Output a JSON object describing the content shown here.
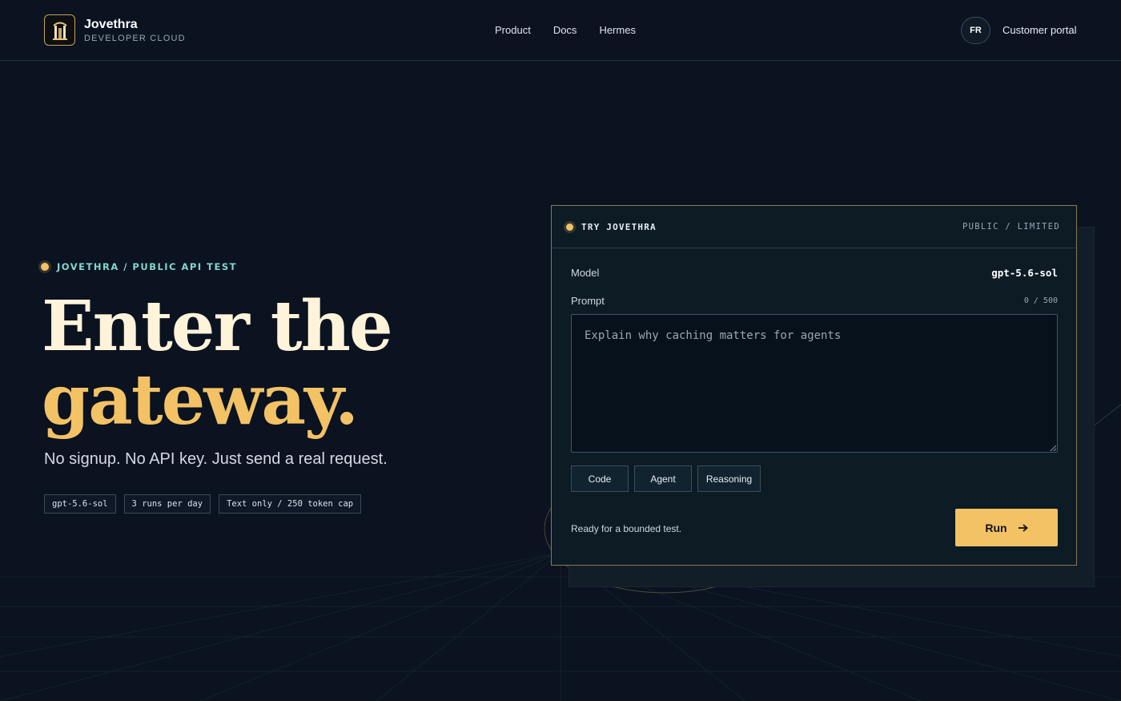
{
  "brand": {
    "name": "Jovethra",
    "subtitle": "DEVELOPER CLOUD"
  },
  "nav": {
    "items": [
      "Product",
      "Docs",
      "Hermes"
    ],
    "language": "FR",
    "portal_label": "Customer portal"
  },
  "hero": {
    "eyebrow": "JOVETHRA / PUBLIC API TEST",
    "headline_line1": "Enter the",
    "headline_line2": "gateway.",
    "subhead": "No signup. No API key. Just send a real request.",
    "chips": [
      "gpt-5.6-sol",
      "3 runs per day",
      "Text only / 250 token cap"
    ]
  },
  "panel": {
    "title": "TRY JOVETHRA",
    "access": "PUBLIC / LIMITED",
    "model_label": "Model",
    "model_value": "gpt-5.6-sol",
    "prompt_label": "Prompt",
    "prompt_counter": "0 / 500",
    "prompt_value": "",
    "prompt_placeholder": "Explain why caching matters for agents",
    "presets": [
      "Code",
      "Agent",
      "Reasoning"
    ],
    "status": "Ready for a bounded test.",
    "run_label": "Run"
  },
  "colors": {
    "background": "#0b1220",
    "accent": "#f2c265",
    "teal": "#7fd8d0",
    "headline_light": "#fff3da"
  },
  "icons": {
    "logo": "pillar-gate-icon",
    "status_dot": "status-dot-icon",
    "run_arrow": "arrow-right-icon"
  }
}
